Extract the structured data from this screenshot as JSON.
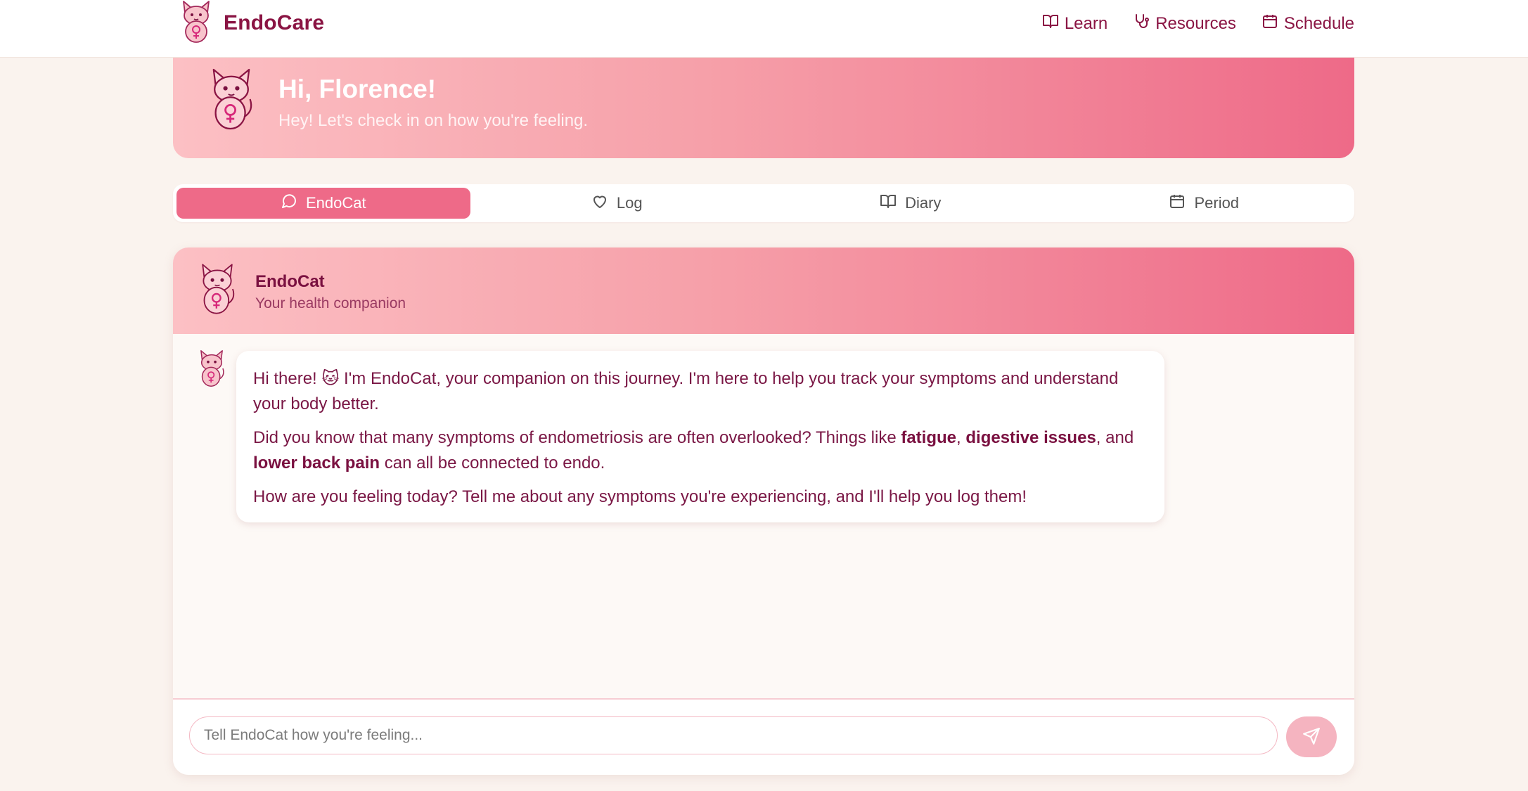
{
  "app": {
    "name": "EndoCare"
  },
  "nav": {
    "links": [
      {
        "label": "Learn",
        "icon": "book-open-icon"
      },
      {
        "label": "Resources",
        "icon": "stethoscope-icon"
      },
      {
        "label": "Schedule",
        "icon": "calendar-icon"
      }
    ]
  },
  "banner": {
    "title": "Hi, Florence!",
    "subtitle": "Hey! Let's check in on how you're feeling."
  },
  "tabs": [
    {
      "label": "EndoCat",
      "icon": "chat-bubble-icon",
      "active": true
    },
    {
      "label": "Log",
      "icon": "heart-icon",
      "active": false
    },
    {
      "label": "Diary",
      "icon": "book-open-icon",
      "active": false
    },
    {
      "label": "Period",
      "icon": "calendar-icon",
      "active": false
    }
  ],
  "chat": {
    "name": "EndoCat",
    "subtitle": "Your health companion",
    "message": {
      "p1": "Hi there! 🐱 I'm EndoCat, your companion on this journey. I'm here to help you track your symptoms and understand your body better.",
      "p2_intro": "Did you know that many symptoms of endometriosis are often overlooked? Things like ",
      "p2_b1": "fatigue",
      "p2_sep1": ", ",
      "p2_b2": "digestive issues",
      "p2_sep2": ", and ",
      "p2_b3": "lower back pain",
      "p2_end": " can all be connected to endo.",
      "p3": "How are you feeling today? Tell me about any symptoms you're experiencing, and I'll help you log them!"
    },
    "input_placeholder": "Tell EndoCat how you're feeling...",
    "input_value": ""
  },
  "colors": {
    "accent": "#ee6a88",
    "brand_text": "#8a1443",
    "banner_start": "#fcc0c4",
    "banner_end": "#ee6a88",
    "page_bg": "#faf3ee",
    "send_button": "#f5b4c0"
  }
}
